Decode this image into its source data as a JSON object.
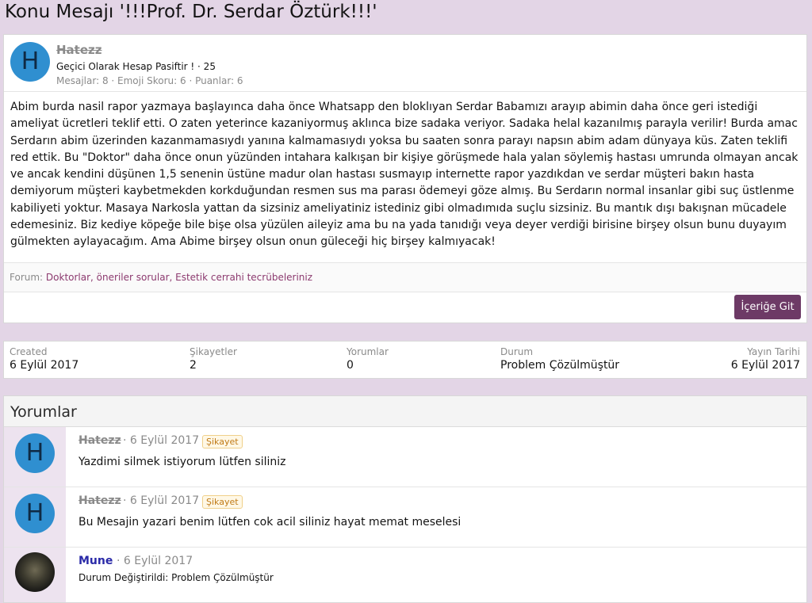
{
  "page_title": "Konu Mesajı '!!!Prof. Dr. Serdar Öztürk!!!'",
  "message": {
    "avatar_letter": "H",
    "username": "Hatezz",
    "user_title": "Geçici Olarak Hesap Pasiftir ! · 25",
    "user_stats": "Mesajlar: 8 · Emoji Skoru: 6 · Puanlar: 6",
    "body": "Abim burda nasil rapor yazmaya başlayınca daha önce Whatsapp den bloklıyan Serdar Babamızı arayıp abimin daha önce geri istediği ameliyat ücretleri teklif etti. O zaten yeterince kazaniyormuş aklınca bize sadaka veriyor. Sadaka helal kazanılmış parayla verilir! Burda amac Serdarın abim üzerinden kazanmamasıydı yanına kalmamasıydı yoksa bu saaten sonra parayı napsın abim adam dünyaya küs. Zaten teklifi red ettik. Bu \"Doktor\" daha önce onun yüzünden intahara kalkışan bir kişiye görüşmede hala yalan söylemiş hastası umrunda olmayan ancak ve ancak kendini düşünen 1,5 senenin üstüne madur olan hastası susmayıp internette rapor yazdıkdan ve serdar müşteri bakın hasta demiyorum müşteri kaybetmekden korkduğundan resmen sus ma parası ödemeyi göze almış. Bu Serdarın normal insanlar gibi suç üstlenme kabiliyeti yoktur. Masaya Narkosla yattan da sizsiniz ameliyatiniz istediniz gibi olmadımıda suçlu sizsiniz. Bu mantık dışı bakışnan mücadele edemesiniz. Biz kediye köpeğe bile bişe olsa yüzülen aileyiz ama bu na yada tanıdığı veya deyer verdiği birisine birşey olsun bunu duyayım gülmekten aylayacağım. Ama Abime birşey olsun onun güleceği hiç birşey kalmıyacak!",
    "forum_label": "Forum:",
    "forum_link": "Doktorlar, öneriler sorular, Estetik cerrahi tecrübeleriniz",
    "goto_button": "İçeriğe Git"
  },
  "stats": [
    {
      "label": "Created",
      "value": "6 Eylül 2017"
    },
    {
      "label": "Şikayetler",
      "value": "2"
    },
    {
      "label": "Yorumlar",
      "value": "0"
    },
    {
      "label": "Durum",
      "value": "Problem Çözülmüştür"
    },
    {
      "label": "Yayın Tarihi",
      "value": "6 Eylül 2017"
    }
  ],
  "comments": {
    "title": "Yorumlar",
    "items": [
      {
        "avatar_letter": "H",
        "name": "Hatezz",
        "date": "· 6 Eylül 2017",
        "badge": "Şikayet",
        "text": "Yazdimi silmek istiyorum lütfen siliniz"
      },
      {
        "avatar_letter": "H",
        "name": "Hatezz",
        "date": "· 6 Eylül 2017",
        "badge": "Şikayet",
        "text": "Bu Mesajin yazari benim lütfen cok acil siliniz hayat memat meselesi"
      },
      {
        "name": "Mune",
        "date": "· 6 Eylül 2017",
        "text": "Durum Değiştirildi: Problem Çözülmüştür"
      }
    ]
  }
}
